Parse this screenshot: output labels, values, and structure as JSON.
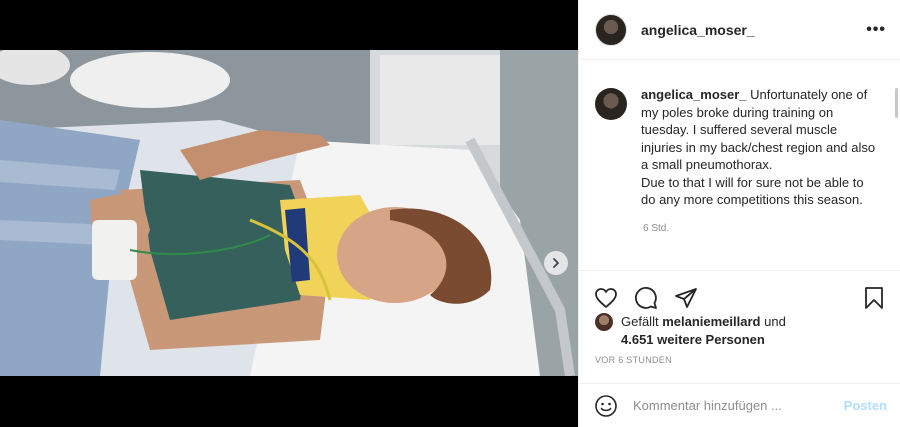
{
  "post": {
    "username": "angelica_moser_",
    "caption": "Unfortunately one of my poles broke during training on tuesday. I suffered several muscle injuries in my back/chest region and also a small pneumothorax.\nDue to that I will for sure not be able to do any more competitions this season.",
    "time_small": "6 Std.",
    "likes_prefix": "Gefällt",
    "likes_user": "melaniemeillard",
    "likes_and": "und",
    "likes_count": "4.651 weitere Personen",
    "posted_ago": "VOR 6 STUNDEN"
  },
  "composer": {
    "placeholder": "Kommentar hinzufügen ...",
    "post_label": "Posten"
  },
  "icons": {
    "more": "more-options-icon",
    "like": "heart-icon",
    "comment": "comment-icon",
    "share": "share-icon",
    "save": "bookmark-icon",
    "emoji": "emoji-icon",
    "next": "chevron-right-icon"
  },
  "carousel": {
    "total": 2,
    "active": 1
  },
  "colors": {
    "post_button": "#b2dffc",
    "muted": "#8e8e8e",
    "text": "#262626"
  }
}
